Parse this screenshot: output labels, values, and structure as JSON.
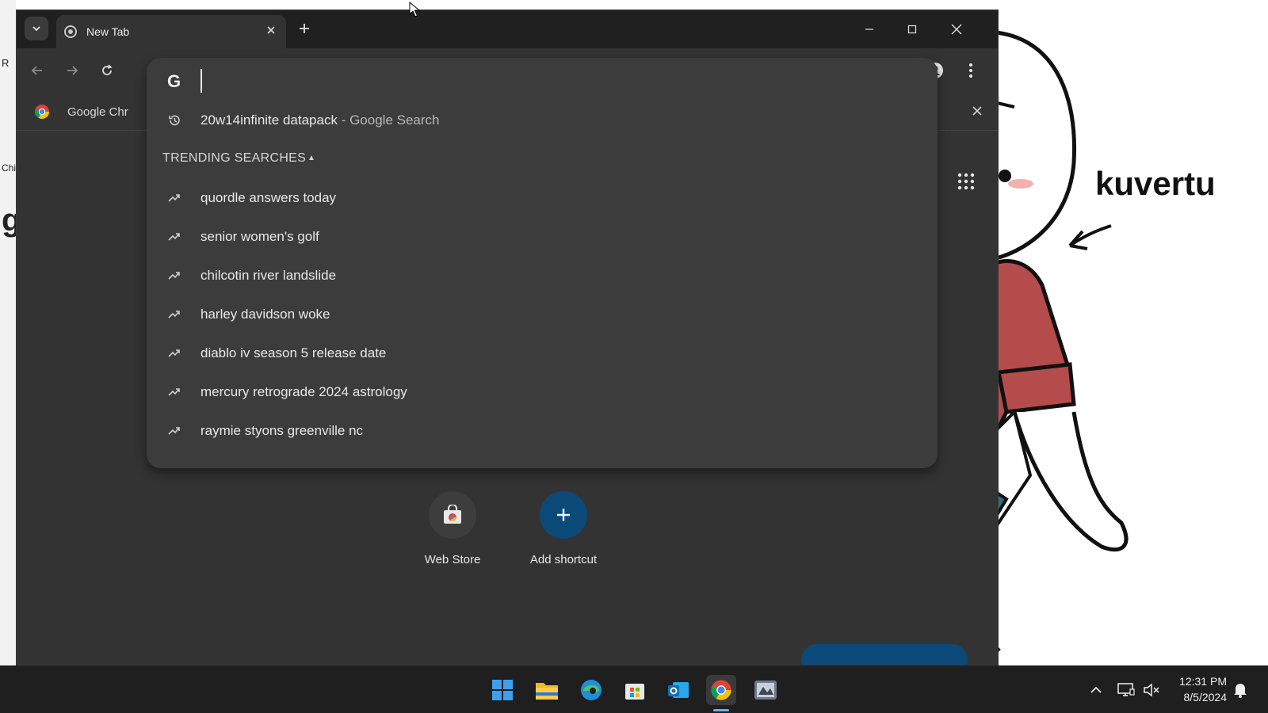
{
  "browser": {
    "tab_title": "New Tab",
    "bookmark_label": "Google Chr",
    "omnibox_value": "",
    "omnibox_history": {
      "query": "20w14infinite datapack",
      "suffix": " - Google Search"
    },
    "trending_header": "TRENDING SEARCHES",
    "trending": [
      "quordle answers today",
      "senior women's golf",
      "chilcotin river landslide",
      "harley davidson woke",
      "diablo iv season 5 release date",
      "mercury retrograde 2024 astrology",
      "raymie styons greenville nc"
    ],
    "shortcuts": [
      {
        "label": "Web Store"
      },
      {
        "label": "Add shortcut"
      }
    ]
  },
  "desktop": {
    "wallpaper_word": "kuvertu",
    "peek_left": [
      "R",
      "Chi",
      "g"
    ]
  },
  "taskbar": {
    "time": "12:31 PM",
    "date": "8/5/2024",
    "apps": [
      "start-icon",
      "file-explorer-icon",
      "edge-icon",
      "store-icon",
      "outlook-icon",
      "chrome-icon",
      "game-icon"
    ]
  },
  "colors": {
    "browser_bg": "#333333",
    "tab_strip": "#202020",
    "dropdown_bg": "#3c3c3c",
    "accent_blue": "#0b4a78",
    "taskbar_bg": "#1f1f1f"
  }
}
